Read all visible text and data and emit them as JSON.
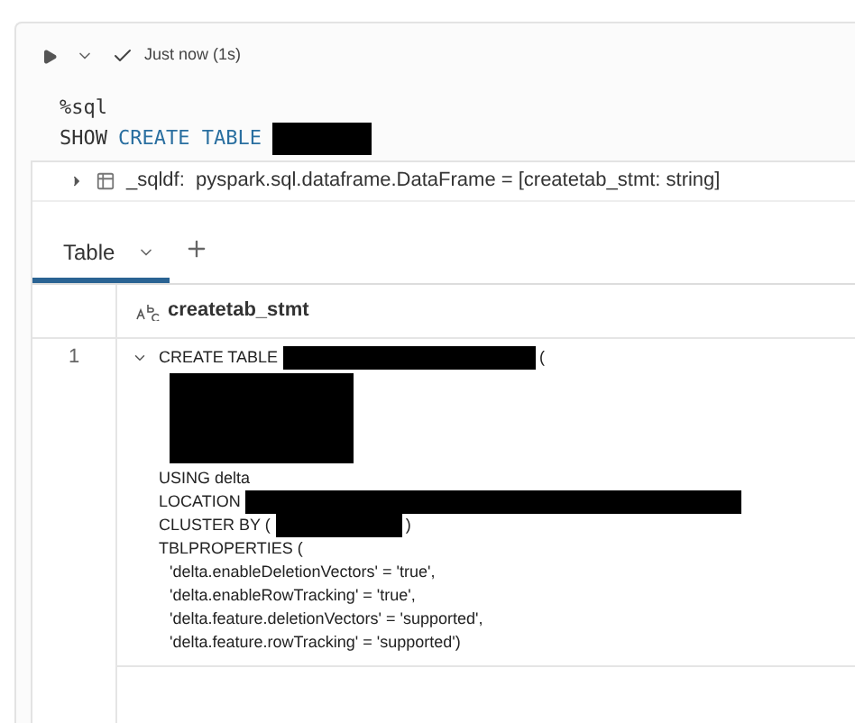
{
  "cell_toolbar": {
    "status": "Just now (1s)",
    "succeeded": true
  },
  "code": [
    {
      "tokens": [
        {
          "kind": "plain",
          "text": "%sql"
        }
      ],
      "redacted": false
    },
    {
      "tokens": [
        {
          "kind": "plain",
          "text": "SHOW"
        },
        {
          "kind": "keyword",
          "text": "CREATE TABLE"
        }
      ],
      "redacted": true
    }
  ],
  "output_header": {
    "expanded": false,
    "text": "_sqldf:  pyspark.sql.dataframe.DataFrame = [createtab_stmt: string]"
  },
  "tabs": [
    {
      "label": "Table",
      "selected": true
    }
  ],
  "table": {
    "columns": [
      {
        "name": "createtab_stmt"
      }
    ],
    "rows": [
      {
        "index": "1",
        "expanded": true,
        "lines": [
          {
            "kind": "text",
            "text": "CREATE TABLE",
            "redacted": true,
            "suffix": "("
          },
          {
            "kind": "block"
          },
          {
            "kind": "text",
            "text": "USING delta",
            "redacted": false
          },
          {
            "kind": "text",
            "text": "LOCATION",
            "redacted": true
          },
          {
            "kind": "text",
            "text": "CLUSTER BY (",
            "redacted": true,
            "suffix": ")"
          },
          {
            "kind": "text",
            "text": "TBLPROPERTIES (",
            "redacted": false
          },
          {
            "kind": "prop",
            "text": "'delta.enableDeletionVectors' = 'true',"
          },
          {
            "kind": "prop",
            "text": "'delta.enableRowTracking' = 'true',"
          },
          {
            "kind": "prop",
            "text": "'delta.feature.deletionVectors' = 'supported',"
          },
          {
            "kind": "prop",
            "text": "'delta.feature.rowTracking' = 'supported')"
          }
        ]
      }
    ]
  }
}
